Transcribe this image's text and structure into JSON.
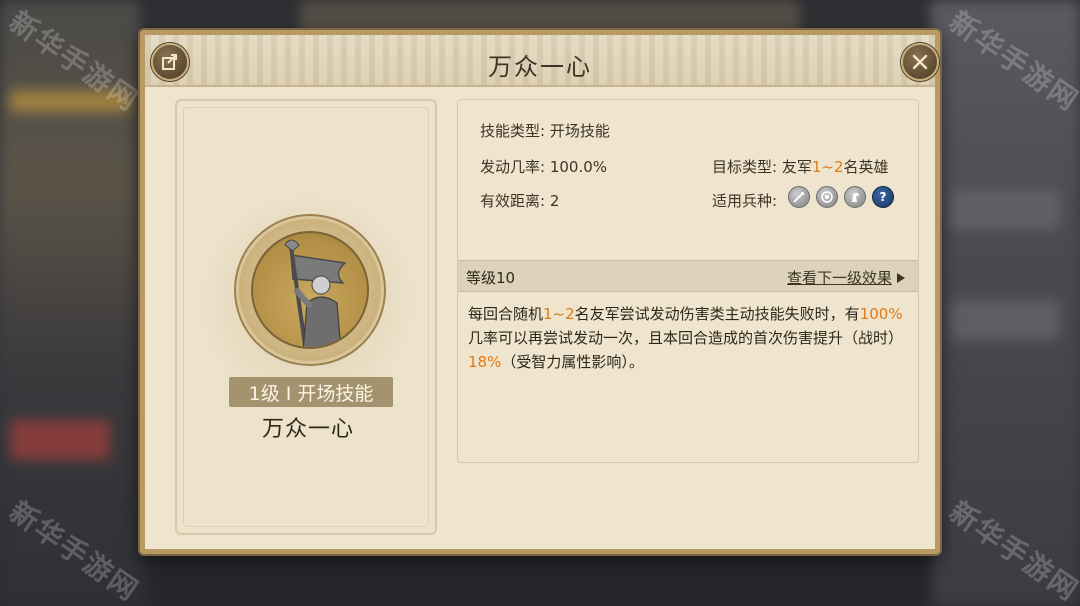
{
  "dialog": {
    "title": "万众一心"
  },
  "left_card": {
    "level_badge": "1级 I 开场技能",
    "skill_name": "万众一心"
  },
  "info": {
    "skill_type": "技能类型: 开场技能",
    "trigger_rate": "发动几率: 100.0%",
    "target_prefix": "目标类型: 友军",
    "target_highlight": "1~2",
    "target_suffix": "名英雄",
    "range": "有效距离: 2",
    "troop_label": "适用兵种:"
  },
  "troop_icons": [
    "sword-icon",
    "target-icon",
    "horse-icon",
    "question-icon"
  ],
  "level": {
    "label": "等级10",
    "next_link": "查看下一级效果"
  },
  "description": {
    "p1": "每回合随机",
    "h1": "1~2",
    "p2": "名友军尝试发动伤害类主动技能失败时，有",
    "h2": "100%",
    "p3": "几率可以再尝试发动一次，且本回合造成的首次伤害提升（战时）",
    "h3": "18%",
    "p4": "（受智力属性影响）。"
  },
  "watermark": "新华手游网",
  "colors": {
    "highlight": "#e07a15",
    "panel_bg": "#efe5cf",
    "border": "#b89a64"
  }
}
